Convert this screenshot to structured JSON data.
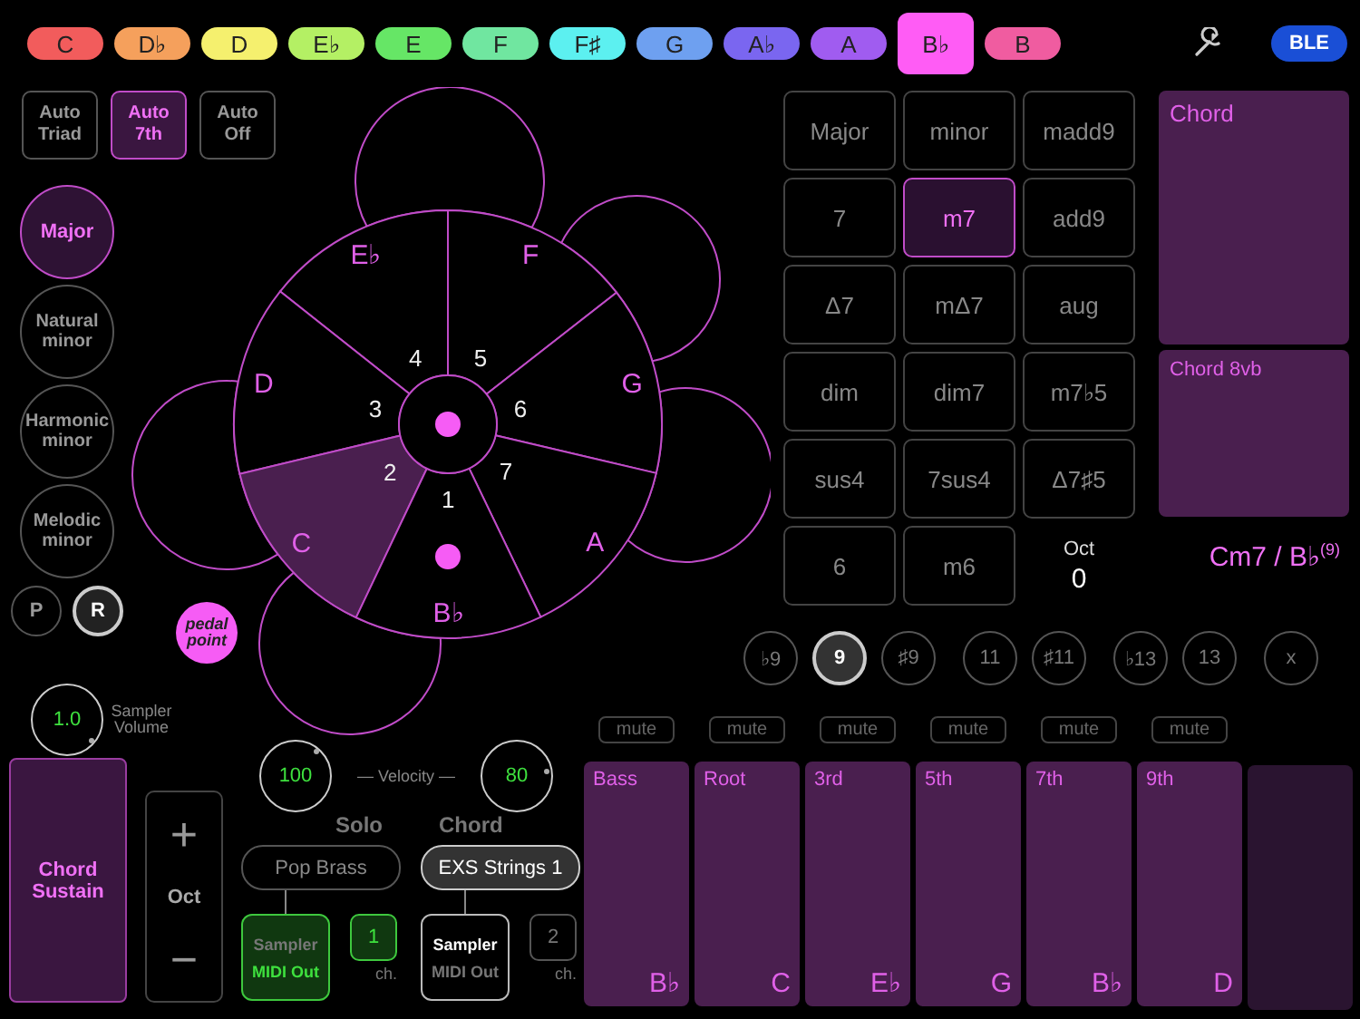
{
  "keys": [
    {
      "label": "C",
      "color": "#f25c5c",
      "selected": false
    },
    {
      "label": "D♭",
      "color": "#f5a05c",
      "selected": false
    },
    {
      "label": "D",
      "color": "#f5f06e",
      "selected": false
    },
    {
      "label": "E♭",
      "color": "#b4f064",
      "selected": false
    },
    {
      "label": "E",
      "color": "#66e666",
      "selected": false
    },
    {
      "label": "F",
      "color": "#70e6a0",
      "selected": false
    },
    {
      "label": "F♯",
      "color": "#5cf0f0",
      "selected": false
    },
    {
      "label": "G",
      "color": "#6ea0f0",
      "selected": false
    },
    {
      "label": "A♭",
      "color": "#7a66f0",
      "selected": false
    },
    {
      "label": "A",
      "color": "#a05cf0",
      "selected": false
    },
    {
      "label": "B♭",
      "color": "#ff5cf5",
      "selected": true
    },
    {
      "label": "B",
      "color": "#f05ca0",
      "selected": false
    }
  ],
  "toolbar": {
    "ble": "BLE"
  },
  "auto_modes": [
    {
      "label": "Auto Triad",
      "selected": false
    },
    {
      "label": "Auto 7th",
      "selected": true
    },
    {
      "label": "Auto Off",
      "selected": false
    }
  ],
  "scales": [
    {
      "label": "Major",
      "selected": true
    },
    {
      "label": "Natural minor",
      "selected": false
    },
    {
      "label": "Harmonic minor",
      "selected": false
    },
    {
      "label": "Melodic minor",
      "selected": false
    }
  ],
  "play_modes": [
    {
      "label": "P",
      "selected": false
    },
    {
      "label": "R",
      "selected": true
    }
  ],
  "pedal_point": {
    "label": "pedal point",
    "on": true
  },
  "sampler_volume": {
    "value": "1.0",
    "label": "Sampler Volume"
  },
  "wheel": {
    "sectors": [
      {
        "note": "E♭",
        "degree": "4",
        "selected": false
      },
      {
        "note": "F",
        "degree": "5",
        "selected": false
      },
      {
        "note": "D",
        "degree": "3",
        "selected": false
      },
      {
        "note": "G",
        "degree": "6",
        "selected": false
      },
      {
        "note": "C",
        "degree": "2",
        "selected": true
      },
      {
        "note": "A",
        "degree": "7",
        "selected": false
      },
      {
        "note": "B♭",
        "degree": "1",
        "selected": false
      }
    ]
  },
  "chord_types": [
    {
      "label": "Major",
      "selected": false
    },
    {
      "label": "minor",
      "selected": false
    },
    {
      "label": "madd9",
      "selected": false
    },
    {
      "label": "7",
      "selected": false
    },
    {
      "label": "m7",
      "selected": true
    },
    {
      "label": "add9",
      "selected": false
    },
    {
      "label": "Δ7",
      "selected": false
    },
    {
      "label": "mΔ7",
      "selected": false
    },
    {
      "label": "aug",
      "selected": false
    },
    {
      "label": "dim",
      "selected": false
    },
    {
      "label": "dim7",
      "selected": false
    },
    {
      "label": "m7♭5",
      "selected": false
    },
    {
      "label": "sus4",
      "selected": false
    },
    {
      "label": "7sus4",
      "selected": false
    },
    {
      "label": "Δ7♯5",
      "selected": false
    },
    {
      "label": "6",
      "selected": false
    },
    {
      "label": "m6",
      "selected": false
    }
  ],
  "octave": {
    "label": "Oct",
    "value": "0"
  },
  "panels": [
    {
      "label": "Chord"
    },
    {
      "label": "Chord 8vb"
    }
  ],
  "chord_name": "Cm7 / B♭$^{(9)}$",
  "extensions": [
    [
      {
        "label": "♭9",
        "selected": false
      },
      {
        "label": "9",
        "selected": true
      },
      {
        "label": "♯9",
        "selected": false
      }
    ],
    [
      {
        "label": "11",
        "selected": false
      },
      {
        "label": "♯11",
        "selected": false
      }
    ],
    [
      {
        "label": "♭13",
        "selected": false
      },
      {
        "label": "13",
        "selected": false
      }
    ],
    [
      {
        "label": "x",
        "selected": false
      }
    ]
  ],
  "voices": [
    {
      "mute": "mute",
      "label": "Bass",
      "note": "B♭"
    },
    {
      "mute": "mute",
      "label": "Root",
      "note": "C"
    },
    {
      "mute": "mute",
      "label": "3rd",
      "note": "E♭"
    },
    {
      "mute": "mute",
      "label": "5th",
      "note": "G"
    },
    {
      "mute": "mute",
      "label": "7th",
      "note": "B♭"
    },
    {
      "mute": "mute",
      "label": "9th",
      "note": "D"
    }
  ],
  "chord_sustain": "Chord Sustain",
  "oct_stepper": {
    "plus": "+",
    "label": "Oct",
    "minus": "−"
  },
  "velocity": {
    "solo": "100",
    "label": "— Velocity —",
    "chord": "80"
  },
  "outputs": [
    {
      "title": "Solo",
      "instrument": "Pop Brass",
      "selected": false,
      "sampler": "Sampler",
      "midi": "MIDI Out",
      "midi_on": true,
      "channel": "1",
      "channel_label": "ch."
    },
    {
      "title": "Chord",
      "instrument": "EXS Strings 1",
      "selected": true,
      "sampler": "Sampler",
      "midi": "MIDI Out",
      "midi_on": false,
      "channel": "2",
      "channel_label": "ch."
    }
  ]
}
